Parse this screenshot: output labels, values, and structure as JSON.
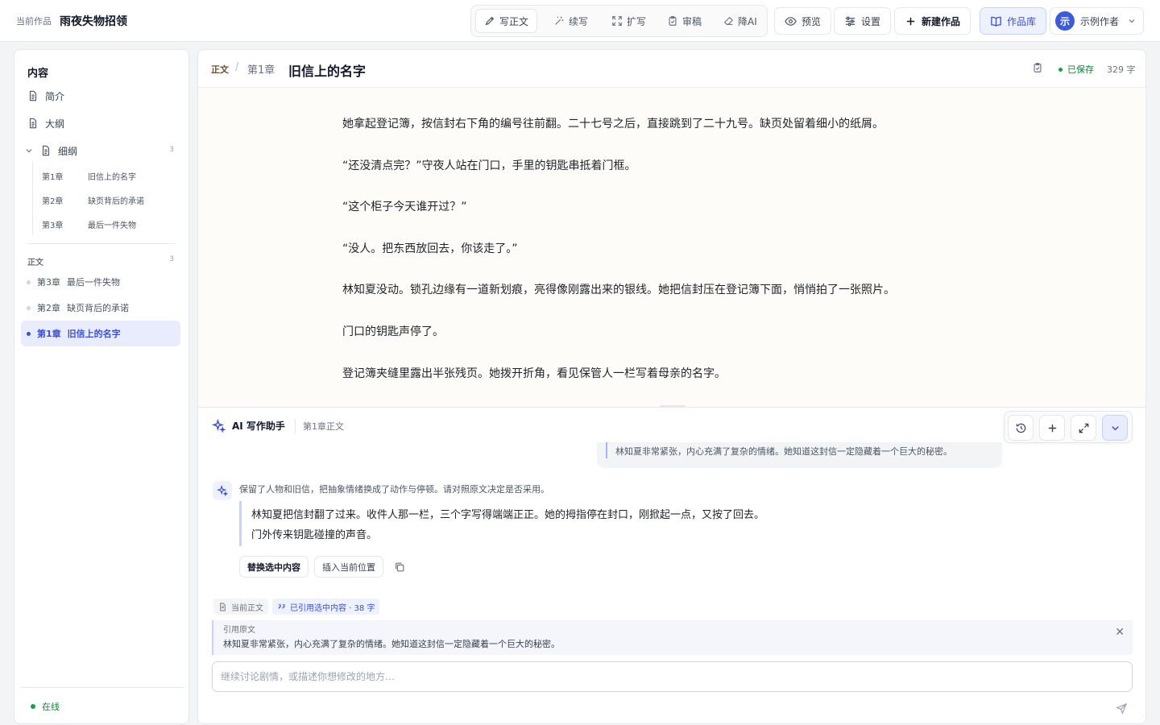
{
  "app": {
    "current_label": "当前作品",
    "current_title": "雨夜失物招领"
  },
  "toolbar": {
    "tools": [
      {
        "label": "写正文",
        "icon": "pencil-icon",
        "active": true
      },
      {
        "label": "续写",
        "icon": "magic-wand-icon",
        "active": false
      },
      {
        "label": "扩写",
        "icon": "expand-icon",
        "active": false
      },
      {
        "label": "审稿",
        "icon": "clipboard-check-icon",
        "active": false
      },
      {
        "label": "降AI",
        "icon": "eraser-icon",
        "active": false
      }
    ],
    "preview_label": "预览",
    "settings_label": "设置",
    "new_work_label": "新建作品",
    "library_label": "作品库",
    "user_initial": "示",
    "user_name": "示例作者"
  },
  "sidebar": {
    "heading": "内容",
    "items": [
      {
        "label": "简介",
        "icon": "document-icon"
      },
      {
        "label": "大纲",
        "icon": "document-icon"
      },
      {
        "label": "细纲",
        "icon": "document-icon",
        "count": "3",
        "expanded": true
      }
    ],
    "outline_chapters": [
      {
        "no": "第1章",
        "title": "旧信上的名字"
      },
      {
        "no": "第2章",
        "title": "缺页背后的承诺"
      },
      {
        "no": "第3章",
        "title": "最后一件失物"
      }
    ],
    "section_label": "正文",
    "section_count": "3",
    "chapters": [
      {
        "no": "第3章",
        "title": "最后一件失物",
        "active": false
      },
      {
        "no": "第2章",
        "title": "缺页背后的承诺",
        "active": false
      },
      {
        "no": "第1章",
        "title": "旧信上的名字",
        "active": true
      }
    ],
    "status": "在线"
  },
  "editor": {
    "crumb_root": "正文",
    "crumb_chapter": "第1章",
    "chapter_title": "旧信上的名字",
    "saved_status": "已保存",
    "word_count": "329 字",
    "paragraphs": [
      "她拿起登记簿，按信封右下角的编号往前翻。二十七号之后，直接跳到了二十九号。缺页处留着细小的纸屑。",
      "“还没清点完？”守夜人站在门口，手里的钥匙串抵着门框。",
      "“这个柜子今天谁开过？”",
      "“没人。把东西放回去，你该走了。”",
      "林知夏没动。锁孔边缘有一道新划痕，亮得像刚露出来的银线。她把信封压在登记簿下面，悄悄拍了一张照片。",
      "门口的钥匙声停了。",
      "登记簿夹缝里露出半张残页。她拨开折角，看见保管人一栏写着母亲的名字。"
    ]
  },
  "ai": {
    "title": "AI 写作助手",
    "context": "第1章正文",
    "user_message": "林知夏非常紧张，内心充满了复杂的情绪。她知道这封信一定隐藏着一个巨大的秘密。",
    "assistant_note": "保留了人物和旧信，把抽象情绪换成了动作与停顿。请对照原文决定是否采用。",
    "suggestion_lines": [
      "林知夏把信封翻了过来。收件人那一栏，三个字写得端端正正。她的拇指停在封口，刚掀起一点，又按了回去。",
      "门外传来钥匙碰撞的声音。"
    ],
    "replace_label": "替换选中内容",
    "insert_label": "插入当前位置",
    "chip_current": "当前正文",
    "chip_quoted": "已引用选中内容 · 38 字",
    "ref_heading": "引用原文",
    "ref_text": "林知夏非常紧张，内心充满了复杂的情绪。她知道这封信一定隐藏着一个巨大的秘密。",
    "input_placeholder": "继续讨论剧情，或描述你想修改的地方…"
  },
  "colors": {
    "accent": "#3b4fd1",
    "success": "#16a34a",
    "editor_bg": "#fdfcf8"
  }
}
